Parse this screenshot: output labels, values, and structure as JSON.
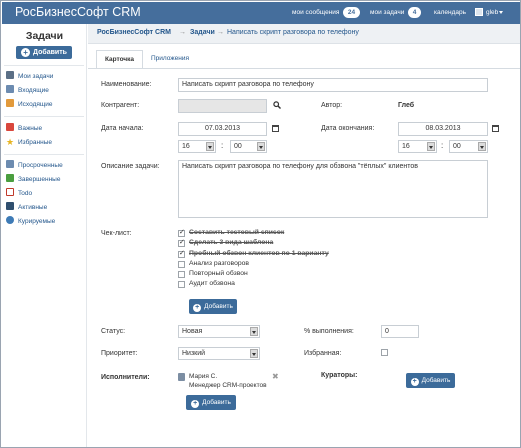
{
  "app": {
    "brand": "РосБизнесСофт CRM"
  },
  "topbar": {
    "messages_label": "мои сообщения",
    "messages_count": "24",
    "tasks_label": "мои задачи",
    "tasks_count": "4",
    "calendar_label": "календарь",
    "user_name": "gleb"
  },
  "sidebar": {
    "title": "Задачи",
    "add_button": "Добавить",
    "group1": [
      {
        "label": "Мои задачи",
        "icon": "list-icon"
      },
      {
        "label": "Входящие",
        "icon": "inbox-icon"
      },
      {
        "label": "Исходящие",
        "icon": "outbox-icon"
      }
    ],
    "group2": [
      {
        "label": "Важные",
        "icon": "important-icon"
      },
      {
        "label": "Избранные",
        "icon": "star-icon"
      }
    ],
    "group3": [
      {
        "label": "Просроченные",
        "icon": "overdue-icon"
      },
      {
        "label": "Завершенные",
        "icon": "check-icon"
      },
      {
        "label": "Todo",
        "icon": "todo-icon"
      },
      {
        "label": "Активные",
        "icon": "activity-icon"
      },
      {
        "label": "Курируемые",
        "icon": "supervised-icon"
      }
    ]
  },
  "breadcrumb": {
    "root": "РосБизнесСофт CRM",
    "section": "Задачи",
    "current": "Написать скрипт разговора по телефону",
    "sep": "→"
  },
  "tabs": [
    {
      "label": "Карточка"
    },
    {
      "label": "Приложения"
    }
  ],
  "form": {
    "name_label": "Наименование:",
    "name_value": "Написать скрипт разговора по телефону",
    "contractor_label": "Контрагент:",
    "contractor_value": "",
    "author_label": "Автор:",
    "author_value": "Глеб",
    "start_label": "Дата начала:",
    "start_date": "07.03.2013",
    "start_hour": "16",
    "start_min": "00",
    "end_label": "Дата окончания:",
    "end_date": "08.03.2013",
    "end_hour": "16",
    "end_min": "00",
    "desc_label": "Описание задачи:",
    "desc_value": "Написать скрипт разговора по телефону для обзвона \"тёплых\" клиентов",
    "checklist_label": "Чек-лист:",
    "checklist": [
      {
        "text": "Составить тестовый список",
        "done": true
      },
      {
        "text": "Сделать 3 вида шаблона",
        "done": true
      },
      {
        "text": "Пробный обзвон клиентов по 1 варианту",
        "done": true
      },
      {
        "text": "Анализ разговоров",
        "done": false
      },
      {
        "text": "Повторный обзвон",
        "done": false
      },
      {
        "text": "Аудит обзвона",
        "done": false
      }
    ],
    "checklist_add": "Добавить",
    "status_label": "Статус:",
    "status_value": "Новая",
    "percent_label": "% выполнения:",
    "percent_value": "0",
    "priority_label": "Приоритет:",
    "priority_value": "Низкий",
    "favorite_label": "Избранная:",
    "executors_label": "Исполнители:",
    "executor_name": "Мария С.",
    "executor_role": "Менеджер CRM-проектов",
    "executors_add": "Добавить",
    "curators_label": "Кураторы:",
    "curators_add": "Добавить"
  }
}
